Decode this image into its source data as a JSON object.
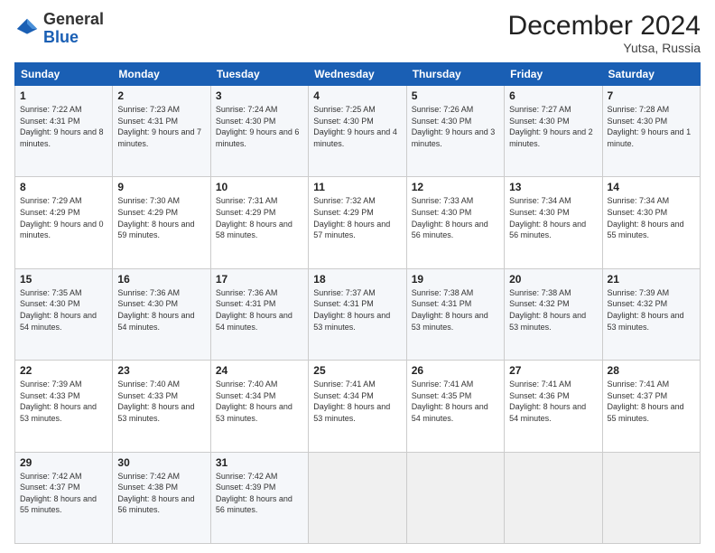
{
  "logo": {
    "general": "General",
    "blue": "Blue"
  },
  "header": {
    "title": "December 2024",
    "subtitle": "Yutsa, Russia"
  },
  "columns": [
    "Sunday",
    "Monday",
    "Tuesday",
    "Wednesday",
    "Thursday",
    "Friday",
    "Saturday"
  ],
  "weeks": [
    [
      {
        "day": "1",
        "sunrise": "Sunrise: 7:22 AM",
        "sunset": "Sunset: 4:31 PM",
        "daylight": "Daylight: 9 hours and 8 minutes."
      },
      {
        "day": "2",
        "sunrise": "Sunrise: 7:23 AM",
        "sunset": "Sunset: 4:31 PM",
        "daylight": "Daylight: 9 hours and 7 minutes."
      },
      {
        "day": "3",
        "sunrise": "Sunrise: 7:24 AM",
        "sunset": "Sunset: 4:30 PM",
        "daylight": "Daylight: 9 hours and 6 minutes."
      },
      {
        "day": "4",
        "sunrise": "Sunrise: 7:25 AM",
        "sunset": "Sunset: 4:30 PM",
        "daylight": "Daylight: 9 hours and 4 minutes."
      },
      {
        "day": "5",
        "sunrise": "Sunrise: 7:26 AM",
        "sunset": "Sunset: 4:30 PM",
        "daylight": "Daylight: 9 hours and 3 minutes."
      },
      {
        "day": "6",
        "sunrise": "Sunrise: 7:27 AM",
        "sunset": "Sunset: 4:30 PM",
        "daylight": "Daylight: 9 hours and 2 minutes."
      },
      {
        "day": "7",
        "sunrise": "Sunrise: 7:28 AM",
        "sunset": "Sunset: 4:30 PM",
        "daylight": "Daylight: 9 hours and 1 minute."
      }
    ],
    [
      {
        "day": "8",
        "sunrise": "Sunrise: 7:29 AM",
        "sunset": "Sunset: 4:29 PM",
        "daylight": "Daylight: 9 hours and 0 minutes."
      },
      {
        "day": "9",
        "sunrise": "Sunrise: 7:30 AM",
        "sunset": "Sunset: 4:29 PM",
        "daylight": "Daylight: 8 hours and 59 minutes."
      },
      {
        "day": "10",
        "sunrise": "Sunrise: 7:31 AM",
        "sunset": "Sunset: 4:29 PM",
        "daylight": "Daylight: 8 hours and 58 minutes."
      },
      {
        "day": "11",
        "sunrise": "Sunrise: 7:32 AM",
        "sunset": "Sunset: 4:29 PM",
        "daylight": "Daylight: 8 hours and 57 minutes."
      },
      {
        "day": "12",
        "sunrise": "Sunrise: 7:33 AM",
        "sunset": "Sunset: 4:30 PM",
        "daylight": "Daylight: 8 hours and 56 minutes."
      },
      {
        "day": "13",
        "sunrise": "Sunrise: 7:34 AM",
        "sunset": "Sunset: 4:30 PM",
        "daylight": "Daylight: 8 hours and 56 minutes."
      },
      {
        "day": "14",
        "sunrise": "Sunrise: 7:34 AM",
        "sunset": "Sunset: 4:30 PM",
        "daylight": "Daylight: 8 hours and 55 minutes."
      }
    ],
    [
      {
        "day": "15",
        "sunrise": "Sunrise: 7:35 AM",
        "sunset": "Sunset: 4:30 PM",
        "daylight": "Daylight: 8 hours and 54 minutes."
      },
      {
        "day": "16",
        "sunrise": "Sunrise: 7:36 AM",
        "sunset": "Sunset: 4:30 PM",
        "daylight": "Daylight: 8 hours and 54 minutes."
      },
      {
        "day": "17",
        "sunrise": "Sunrise: 7:36 AM",
        "sunset": "Sunset: 4:31 PM",
        "daylight": "Daylight: 8 hours and 54 minutes."
      },
      {
        "day": "18",
        "sunrise": "Sunrise: 7:37 AM",
        "sunset": "Sunset: 4:31 PM",
        "daylight": "Daylight: 8 hours and 53 minutes."
      },
      {
        "day": "19",
        "sunrise": "Sunrise: 7:38 AM",
        "sunset": "Sunset: 4:31 PM",
        "daylight": "Daylight: 8 hours and 53 minutes."
      },
      {
        "day": "20",
        "sunrise": "Sunrise: 7:38 AM",
        "sunset": "Sunset: 4:32 PM",
        "daylight": "Daylight: 8 hours and 53 minutes."
      },
      {
        "day": "21",
        "sunrise": "Sunrise: 7:39 AM",
        "sunset": "Sunset: 4:32 PM",
        "daylight": "Daylight: 8 hours and 53 minutes."
      }
    ],
    [
      {
        "day": "22",
        "sunrise": "Sunrise: 7:39 AM",
        "sunset": "Sunset: 4:33 PM",
        "daylight": "Daylight: 8 hours and 53 minutes."
      },
      {
        "day": "23",
        "sunrise": "Sunrise: 7:40 AM",
        "sunset": "Sunset: 4:33 PM",
        "daylight": "Daylight: 8 hours and 53 minutes."
      },
      {
        "day": "24",
        "sunrise": "Sunrise: 7:40 AM",
        "sunset": "Sunset: 4:34 PM",
        "daylight": "Daylight: 8 hours and 53 minutes."
      },
      {
        "day": "25",
        "sunrise": "Sunrise: 7:41 AM",
        "sunset": "Sunset: 4:34 PM",
        "daylight": "Daylight: 8 hours and 53 minutes."
      },
      {
        "day": "26",
        "sunrise": "Sunrise: 7:41 AM",
        "sunset": "Sunset: 4:35 PM",
        "daylight": "Daylight: 8 hours and 54 minutes."
      },
      {
        "day": "27",
        "sunrise": "Sunrise: 7:41 AM",
        "sunset": "Sunset: 4:36 PM",
        "daylight": "Daylight: 8 hours and 54 minutes."
      },
      {
        "day": "28",
        "sunrise": "Sunrise: 7:41 AM",
        "sunset": "Sunset: 4:37 PM",
        "daylight": "Daylight: 8 hours and 55 minutes."
      }
    ],
    [
      {
        "day": "29",
        "sunrise": "Sunrise: 7:42 AM",
        "sunset": "Sunset: 4:37 PM",
        "daylight": "Daylight: 8 hours and 55 minutes."
      },
      {
        "day": "30",
        "sunrise": "Sunrise: 7:42 AM",
        "sunset": "Sunset: 4:38 PM",
        "daylight": "Daylight: 8 hours and 56 minutes."
      },
      {
        "day": "31",
        "sunrise": "Sunrise: 7:42 AM",
        "sunset": "Sunset: 4:39 PM",
        "daylight": "Daylight: 8 hours and 56 minutes."
      },
      null,
      null,
      null,
      null
    ]
  ]
}
